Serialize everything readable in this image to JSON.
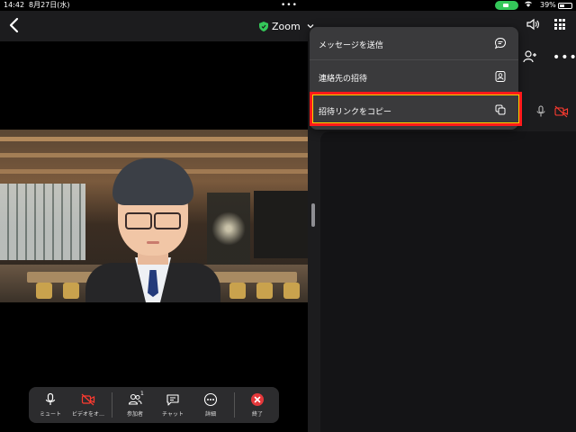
{
  "status_bar": {
    "time": "14:42",
    "date": "8月27日(水)",
    "multitask_dots": "•••",
    "battery": "39%"
  },
  "top_bar": {
    "title": "Zoom"
  },
  "menu": {
    "items": [
      {
        "label": "メッセージを送信",
        "icon": "chat-bubble-icon"
      },
      {
        "label": "連絡先の招待",
        "icon": "contact-icon"
      },
      {
        "label": "招待リンクをコピー",
        "icon": "copy-icon"
      }
    ],
    "highlight_color": "#ff1a1a"
  },
  "panel": {
    "more": "•••"
  },
  "controls": {
    "items": [
      {
        "label": "ミュート",
        "icon": "microphone-icon"
      },
      {
        "label": "ビデオをオ…",
        "icon": "video-off-icon"
      },
      {
        "label": "参加者",
        "icon": "participants-icon",
        "badge": "1"
      },
      {
        "label": "チャット",
        "icon": "chat-icon"
      },
      {
        "label": "詳細",
        "icon": "more-icon"
      },
      {
        "label": "終了",
        "icon": "end-icon"
      }
    ]
  },
  "colors": {
    "accent_green": "#34c759",
    "end_red": "#e5383b",
    "video_off_red": "#ff3b30"
  }
}
